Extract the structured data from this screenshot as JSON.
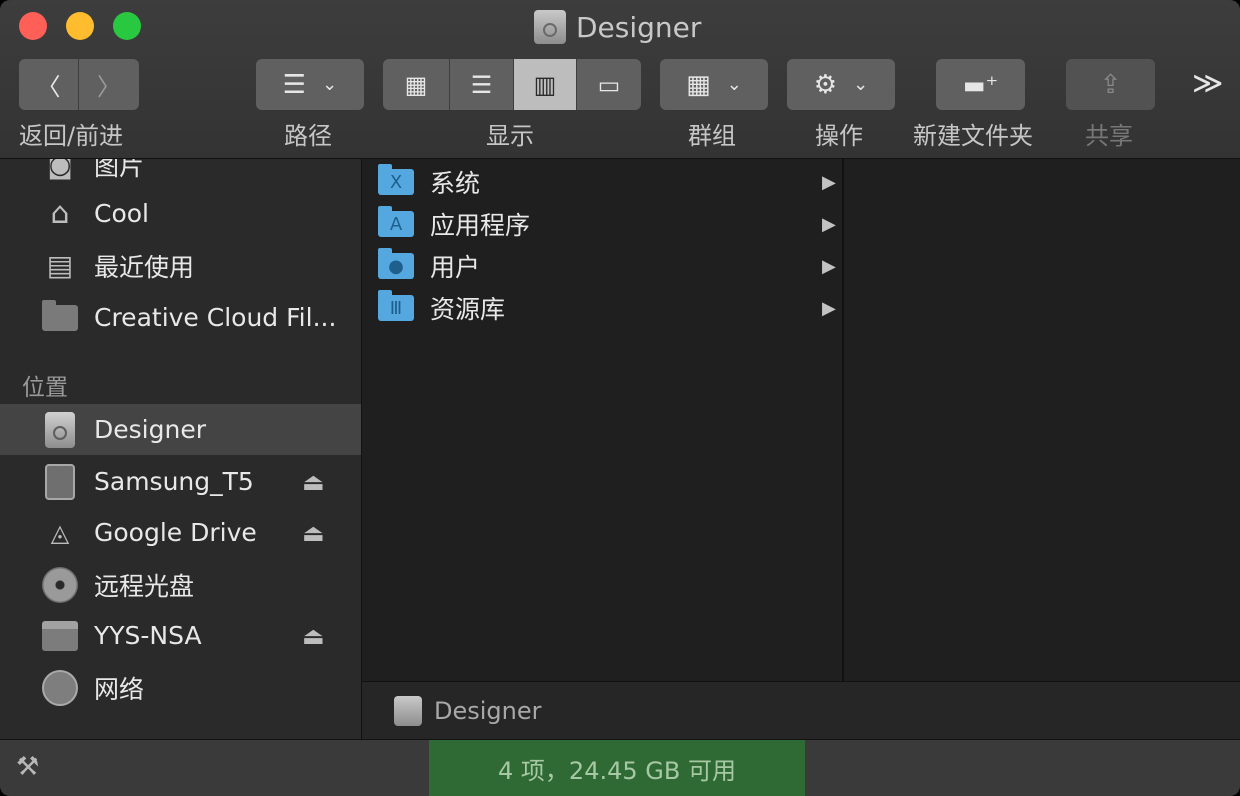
{
  "window": {
    "title": "Designer"
  },
  "toolbar": {
    "back_glyph": "〈",
    "forward_glyph": "〉",
    "back_forward_label": "返回/前进",
    "path_label": "路径",
    "view_label": "显示",
    "group_label": "群组",
    "action_label": "操作",
    "new_folder_label": "新建文件夹",
    "share_label": "共享",
    "more_glyph": "≫"
  },
  "sidebar": {
    "favorites": [
      {
        "label": "图片",
        "icon": "camera-icon"
      },
      {
        "label": "Cool",
        "icon": "home-icon"
      },
      {
        "label": "最近使用",
        "icon": "recents-icon"
      },
      {
        "label": "Creative Cloud Fil...",
        "icon": "folder-icon"
      }
    ],
    "locations_header": "位置",
    "locations": [
      {
        "label": "Designer",
        "icon": "hard-drive-icon",
        "eject": false,
        "selected": true
      },
      {
        "label": "Samsung_T5",
        "icon": "external-drive-icon",
        "eject": true
      },
      {
        "label": "Google Drive",
        "icon": "google-drive-icon",
        "eject": true
      },
      {
        "label": "远程光盘",
        "icon": "disc-icon",
        "eject": false
      },
      {
        "label": "YYS-NSA",
        "icon": "nas-icon",
        "eject": true
      },
      {
        "label": "网络",
        "icon": "network-icon",
        "eject": false
      }
    ]
  },
  "column1": {
    "items": [
      {
        "label": "系统",
        "icon": "system-folder-icon",
        "badge": "X"
      },
      {
        "label": "应用程序",
        "icon": "applications-folder-icon",
        "badge": "A"
      },
      {
        "label": "用户",
        "icon": "users-folder-icon",
        "badge": "●"
      },
      {
        "label": "资源库",
        "icon": "library-folder-icon",
        "badge": "Ⅲ"
      }
    ]
  },
  "pathbar": {
    "label": "Designer"
  },
  "statusbar": {
    "status": "4 项，24.45 GB 可用"
  },
  "colors": {
    "accent_status": "#2f6a34",
    "folder_blue": "#55a7e0"
  }
}
